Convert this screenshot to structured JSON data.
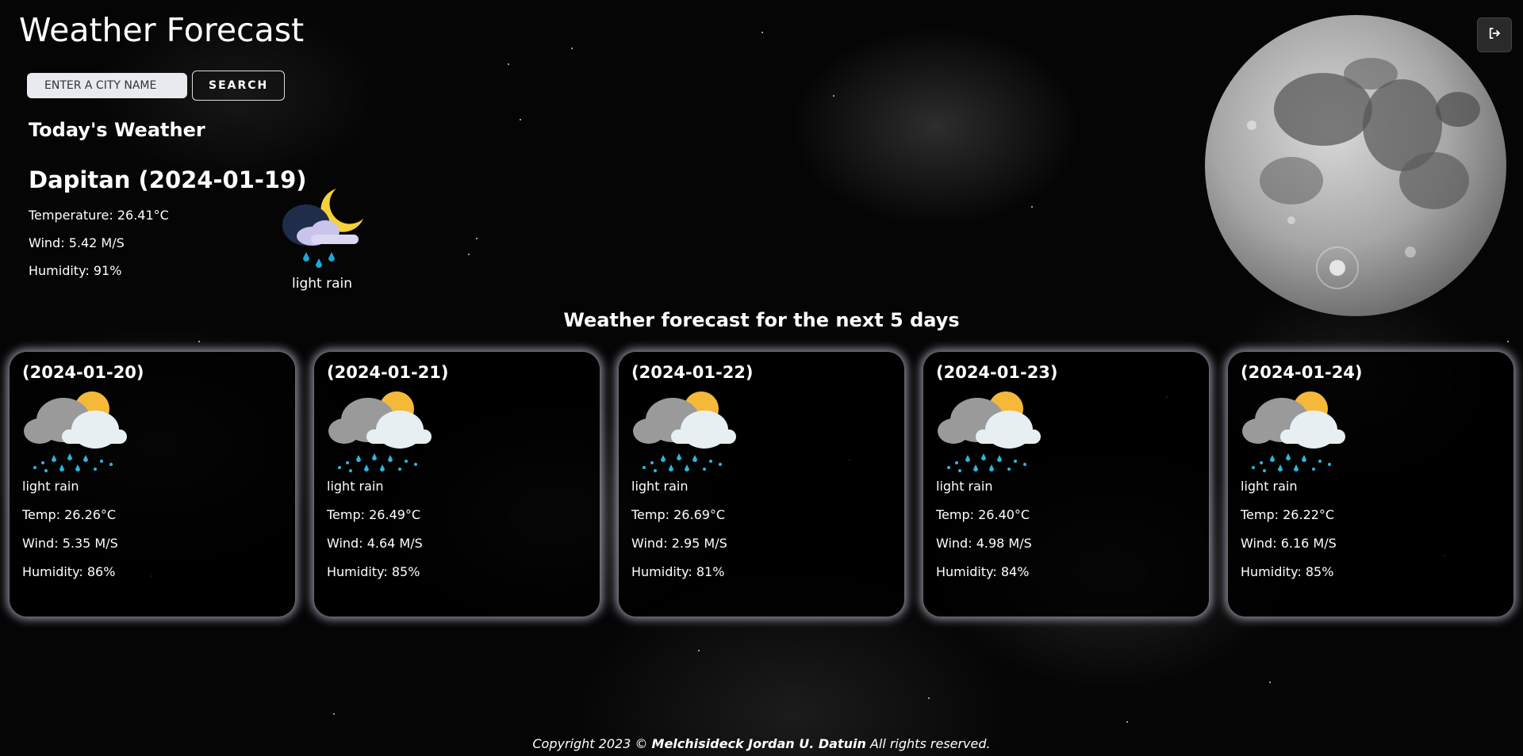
{
  "app": {
    "title": "Weather Forecast"
  },
  "search": {
    "placeholder": "ENTER A CITY NAME",
    "button_label": "SEARCH"
  },
  "today": {
    "heading": "Today's Weather",
    "city_date": "Dapitan (2024-01-19)",
    "temperature": "Temperature: 26.41°C",
    "wind": "Wind: 5.42 M/S",
    "humidity": "Humidity: 91%",
    "description": "light rain",
    "icon": "night-cloud-rain-icon"
  },
  "forecast": {
    "heading": "Weather forecast for the next 5 days",
    "days": [
      {
        "date": "(2024-01-20)",
        "description": "light rain",
        "temp": "Temp: 26.26°C",
        "wind": "Wind: 5.35 M/S",
        "humidity": "Humidity: 86%",
        "icon": "sun-cloud-rain-icon"
      },
      {
        "date": "(2024-01-21)",
        "description": "light rain",
        "temp": "Temp: 26.49°C",
        "wind": "Wind: 4.64 M/S",
        "humidity": "Humidity: 85%",
        "icon": "sun-cloud-rain-icon"
      },
      {
        "date": "(2024-01-22)",
        "description": "light rain",
        "temp": "Temp: 26.69°C",
        "wind": "Wind: 2.95 M/S",
        "humidity": "Humidity: 81%",
        "icon": "sun-cloud-rain-icon"
      },
      {
        "date": "(2024-01-23)",
        "description": "light rain",
        "temp": "Temp: 26.40°C",
        "wind": "Wind: 4.98 M/S",
        "humidity": "Humidity: 84%",
        "icon": "sun-cloud-rain-icon"
      },
      {
        "date": "(2024-01-24)",
        "description": "light rain",
        "temp": "Temp: 26.22°C",
        "wind": "Wind: 6.16 M/S",
        "humidity": "Humidity: 85%",
        "icon": "sun-cloud-rain-icon"
      }
    ]
  },
  "footer": {
    "prefix": "Copyright 2023 © ",
    "author": "Melchisideck Jordan U. Datuin",
    "suffix": " All rights reserved."
  },
  "icons": {
    "logout": "logout-icon",
    "moon": "moon-image"
  }
}
